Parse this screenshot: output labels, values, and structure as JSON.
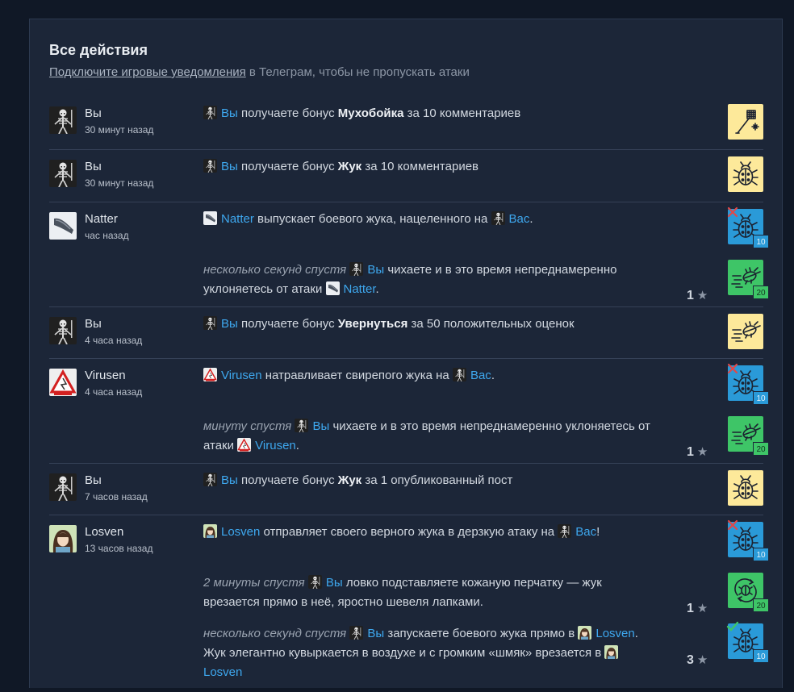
{
  "header": {
    "title": "Все действия",
    "link_text": "Подключите игровые уведомления",
    "subtitle_rest": " в Телеграм, чтобы не пропускать атаки"
  },
  "rows": [
    {
      "name": "Вы",
      "time": "30 минут назад",
      "msg": {
        "user": "Вы",
        "a": " получаете бонус ",
        "bold": "Мухобойка",
        "b": " за 10 комментариев"
      }
    },
    {
      "name": "Вы",
      "time": "30 минут назад",
      "msg": {
        "user": "Вы",
        "a": " получаете бонус ",
        "bold": "Жук",
        "b": " за 10 комментариев"
      }
    },
    {
      "name": "Natter",
      "time": "час назад",
      "msg": {
        "user": "Natter",
        "a": " выпускает боевого жука, нацеленного на ",
        "target": "Вас",
        "b": "."
      },
      "badge": "10",
      "sub": {
        "ago": "несколько секунд спустя",
        "user": "Вы",
        "a": " чихаете и в это время непреднамеренно уклоняетесь от атаки ",
        "target": "Natter",
        "b": ".",
        "score": "1",
        "badge": "20"
      }
    },
    {
      "name": "Вы",
      "time": "4 часа назад",
      "msg": {
        "user": "Вы",
        "a": " получаете бонус ",
        "bold": "Увернуться",
        "b": " за 50 положительных оценок"
      }
    },
    {
      "name": "Virusen",
      "time": "4 часа назад",
      "msg": {
        "user": "Virusen",
        "a": " натравливает свирепого жука на ",
        "target": "Вас",
        "b": "."
      },
      "badge": "10",
      "sub": {
        "ago": "минуту спустя",
        "user": "Вы",
        "a": " чихаете и в это время непреднамеренно уклоняетесь от атаки ",
        "target": "Virusen",
        "b": ".",
        "score": "1",
        "badge": "20"
      }
    },
    {
      "name": "Вы",
      "time": "7 часов назад",
      "msg": {
        "user": "Вы",
        "a": " получаете бонус ",
        "bold": "Жук",
        "b": " за 1 опубликованный пост"
      }
    },
    {
      "name": "Losven",
      "time": "13 часов назад",
      "msg": {
        "user": "Losven",
        "a": " отправляет своего верного жука в дерзкую атаку на ",
        "target": "Вас",
        "b": "!"
      },
      "badge": "10",
      "sub": {
        "ago": "2 минуты спустя",
        "user": "Вы",
        "a": " ловко подставляете кожаную перчатку — жук врезается прямо в неё, яростно шевеля лапками.",
        "score": "1",
        "badge": "20"
      },
      "sub2": {
        "ago": "несколько секунд спустя",
        "user": "Вы",
        "a": " запускаете боевого жука прямо в ",
        "target": "Losven",
        "b": ". Жук элегантно кувыркается в воздухе и с громким «шмяк» врезается в ",
        "target2": "Losven",
        "score": "3",
        "badge": "10"
      }
    }
  ],
  "colors": {
    "yellow_tile": "#fde99a",
    "blue_tile": "#2a9ad8",
    "green_tile": "#3ec567",
    "link": "#3ea8ef"
  }
}
